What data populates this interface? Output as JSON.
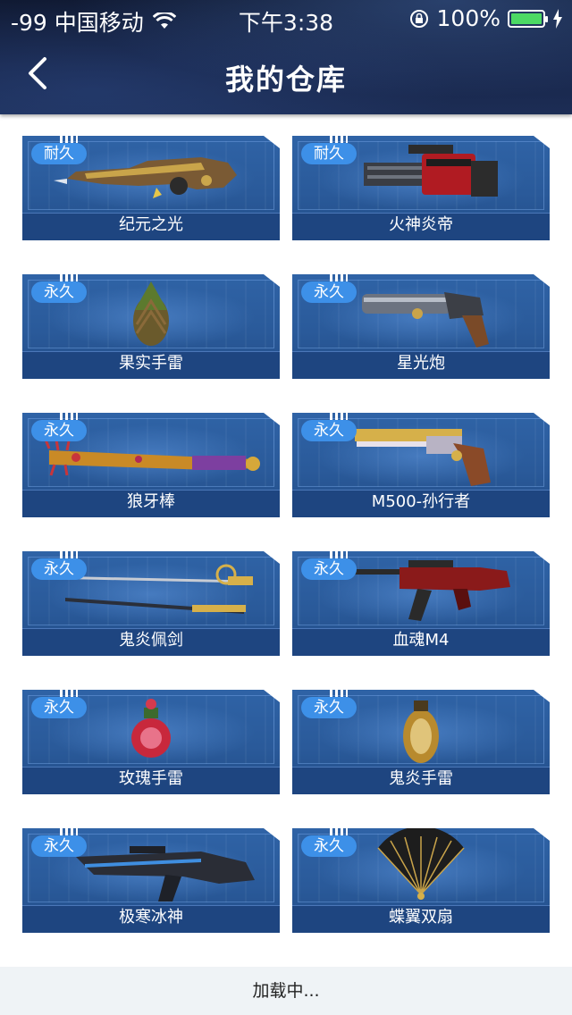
{
  "status_bar": {
    "carrier": "-99 中国移动",
    "time": "下午3:38",
    "battery": "100%",
    "battery_level": 1.0
  },
  "nav": {
    "title": "我的仓库",
    "back_icon": "chevron-left-icon"
  },
  "items": [
    {
      "badge": "耐久",
      "name": "纪元之光",
      "icon": "rifle-icon"
    },
    {
      "badge": "耐久",
      "name": "火神炎帝",
      "icon": "minigun-icon"
    },
    {
      "badge": "永久",
      "name": "果实手雷",
      "icon": "grenade-icon"
    },
    {
      "badge": "永久",
      "name": "星光炮",
      "icon": "cannon-icon"
    },
    {
      "badge": "永久",
      "name": "狼牙棒",
      "icon": "bat-icon"
    },
    {
      "badge": "永久",
      "name": "M500-孙行者",
      "icon": "revolver-icon"
    },
    {
      "badge": "永久",
      "name": "鬼炎佩剑",
      "icon": "sword-icon"
    },
    {
      "badge": "永久",
      "name": "血魂M4",
      "icon": "assault-rifle-icon"
    },
    {
      "badge": "永久",
      "name": "玫瑰手雷",
      "icon": "rose-grenade-icon"
    },
    {
      "badge": "永久",
      "name": "鬼炎手雷",
      "icon": "frag-grenade-icon"
    },
    {
      "badge": "永久",
      "name": "极寒冰神",
      "icon": "ice-rifle-icon"
    },
    {
      "badge": "永久",
      "name": "蝶翼双扇",
      "icon": "fan-icon"
    }
  ],
  "footer": {
    "loading_text": "加载中..."
  },
  "colors": {
    "badge": "#3d90e8",
    "card": "#2f63a6",
    "battery": "#4cd964"
  }
}
